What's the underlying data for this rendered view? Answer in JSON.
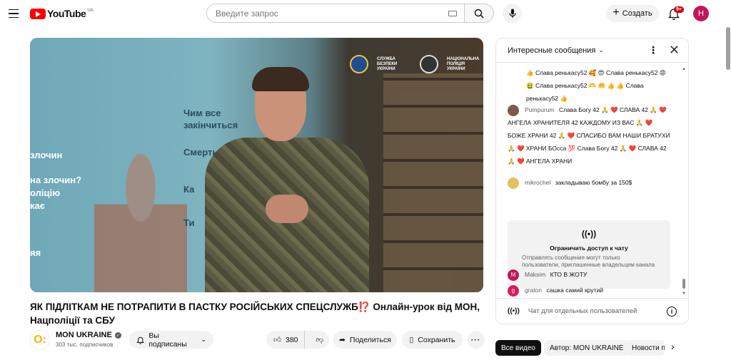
{
  "header": {
    "logo_text": "YouTube",
    "region": "UA",
    "search_placeholder": "Введите запрос",
    "create_label": "Создать",
    "notifications_badge": "9+",
    "avatar_letter": "Н"
  },
  "video": {
    "overlay": {
      "wall_line1": "Чим все",
      "wall_line2": "закінчиться",
      "wall_line3": "Смерть",
      "wall_line4": "Ка",
      "wall_line5": "Ти",
      "left_line1": "злочин",
      "left_line2": "на злочин?",
      "left_line3": "оліцію",
      "left_line4": "кає",
      "left_line5": "яя",
      "logo1": "СЛУЖБА БЕЗПЕКИ УКРАЇНИ",
      "logo2": "НАЦІОНАЛЬНА ПОЛІЦІЯ УКРАЇНИ"
    },
    "title": "ЯК ПІДЛІТКАМ НЕ ПОТРАПИТИ В ПАСТКУ РОСІЙСЬКИХ СПЕЦСЛУЖБ⁉️ Онлайн-урок від МОН, Нацполіції та СБУ"
  },
  "channel": {
    "name": "MON UKRAINE",
    "subscribers": "303 тыс. подписчиков",
    "subscribe_label": "Вы подписаны"
  },
  "actions": {
    "likes": "380",
    "share_label": "Поделиться",
    "save_label": "Сохранить",
    "more_label": "···"
  },
  "chat": {
    "mode_label": "Интересные сообщения",
    "messages": [
      {
        "author": "",
        "text": "👍 Слава ренькасу52 🥰 😍 Слава ренькасу52 😡 🤮 Слава ренькасу52 🫶 🤲 👍 👍 Слава ренькасу52 👍"
      },
      {
        "author": "Pumpurum",
        "text": "Слава Богу 42 🙏 ❤️ СЛАВА 42 🙏 ❤️ АНГЕЛА ХРАНИТЕЛЯ 42 КАЖДОМУ ИЗ ВАС 🙏 ❤️ БОЖЕ ХРАНИ 42 🙏 ❤️ СПАСИБО ВАМ НАШИ БРАТУХИ 🙏 ❤️ ХРАНИ БОсса 💯 Слава Богу 42 🙏 ❤️ СЛАВА 42 🙏 ❤️ АНГЕЛА ХРАНИ"
      },
      {
        "author": "mikrochel",
        "text": "закладываю бомбу за 150$"
      },
      {
        "author": "Maksim",
        "text": "КТО В ЖОТУ"
      },
      {
        "author": "graton",
        "text": "сашка самий крутий"
      }
    ],
    "restricted": {
      "title": "Ограничить доступ к чату",
      "desc": "Отправлять сообщения могут только пользователи, приглашенные владельцем канала"
    },
    "footer_text": "Чат для отдельных пользователей"
  },
  "chips": [
    "Все видео",
    "Автор: MON UKRAINE",
    "Новости п"
  ],
  "colors": {
    "accent": "#ff0000",
    "badge": "#cc0000",
    "avatar": "#c2185b"
  }
}
